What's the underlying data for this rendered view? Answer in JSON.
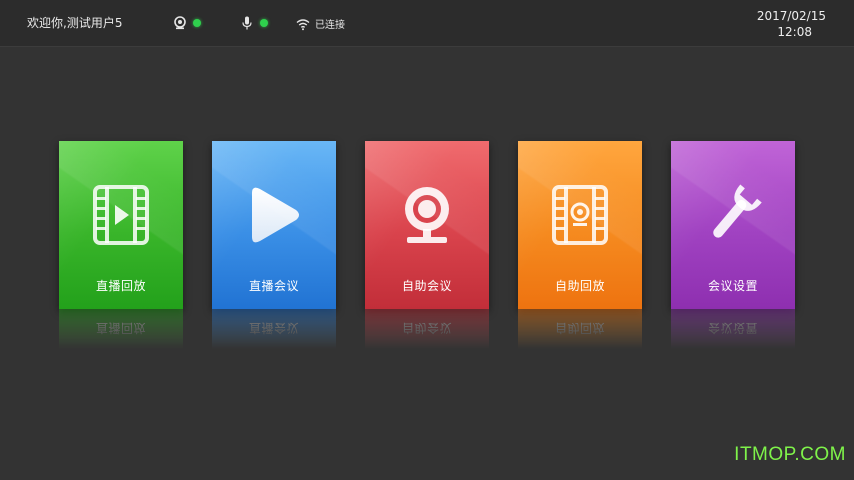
{
  "header": {
    "welcome_text": "欢迎你,测试用户5",
    "camera_icon": "camera-icon",
    "mic_icon": "microphone-icon",
    "wifi_icon": "wifi-icon",
    "network_label": "已连接",
    "status_color": "#2fd14d",
    "date": "2017/02/15",
    "time": "12:08"
  },
  "tiles": [
    {
      "label": "直播回放",
      "icon": "film-play-icon",
      "color": "#39b52a"
    },
    {
      "label": "直播会议",
      "icon": "play-icon",
      "color": "#3a8fe6"
    },
    {
      "label": "自助会议",
      "icon": "webcam-icon",
      "color": "#d9434c"
    },
    {
      "label": "自助回放",
      "icon": "film-webcam-icon",
      "color": "#f58a1f"
    },
    {
      "label": "会议设置",
      "icon": "wrench-icon",
      "color": "#a042c1"
    }
  ],
  "watermark": "ITMOP.COM"
}
